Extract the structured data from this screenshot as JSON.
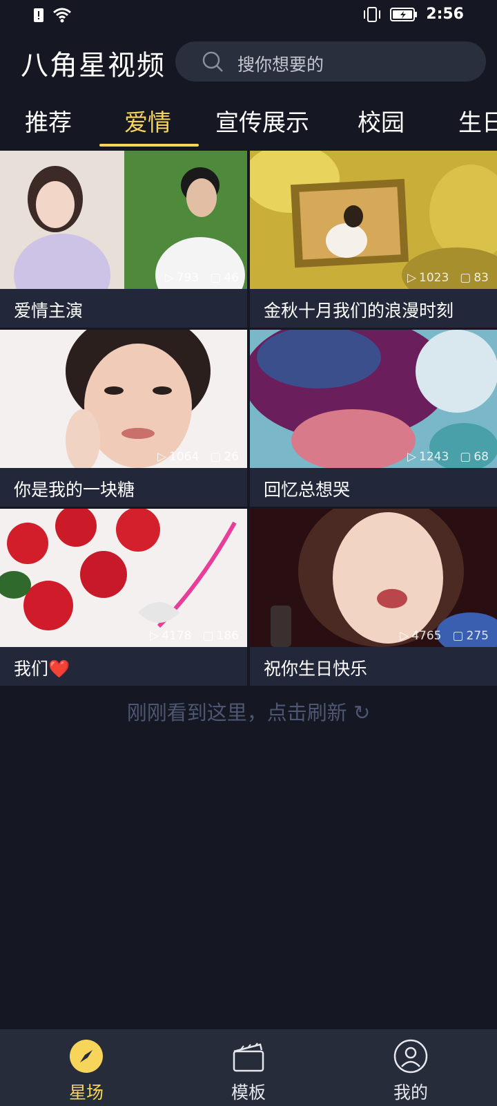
{
  "status_bar": {
    "time": "2:56"
  },
  "header": {
    "app_title": "八角星视频",
    "search_placeholder": "搜你想要的"
  },
  "tabs": [
    {
      "label": "推荐",
      "active": false
    },
    {
      "label": "爱情",
      "active": true
    },
    {
      "label": "宣传展示",
      "active": false
    },
    {
      "label": "校园",
      "active": false
    },
    {
      "label": "生日",
      "active": false
    }
  ],
  "cards": [
    {
      "title": "爱情主演",
      "views": "793",
      "likes": "46"
    },
    {
      "title": "金秋十月我们的浪漫时刻",
      "views": "1023",
      "likes": "83"
    },
    {
      "title": "你是我的一块糖",
      "views": "1064",
      "likes": "26"
    },
    {
      "title": "回忆总想哭",
      "views": "1243",
      "likes": "68"
    },
    {
      "title": "我们",
      "views": "4178",
      "likes": "186",
      "emoji": "❤️"
    },
    {
      "title": "祝你生日快乐",
      "views": "4765",
      "likes": "275"
    }
  ],
  "refresh_text": "刚刚看到这里，点击刷新 ↻",
  "bottom_nav": [
    {
      "label": "星场",
      "icon": "compass-icon",
      "active": true
    },
    {
      "label": "模板",
      "icon": "clapperboard-icon",
      "active": false
    },
    {
      "label": "我的",
      "icon": "profile-icon",
      "active": false
    }
  ],
  "colors": {
    "accent": "#f7d55b",
    "background": "#151823",
    "card": "#22273a",
    "nav": "#272c3a"
  }
}
